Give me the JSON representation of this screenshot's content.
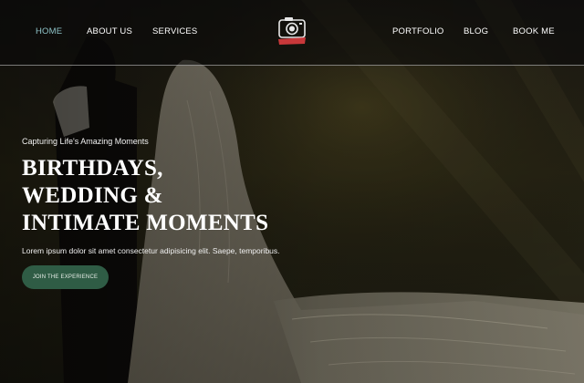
{
  "nav": {
    "left": [
      {
        "label": "HOME",
        "active": true
      },
      {
        "label": "ABOUT US",
        "active": false
      },
      {
        "label": "SERVICES",
        "active": false
      }
    ],
    "right": [
      {
        "label": "PORTFOLIO",
        "active": false
      },
      {
        "label": "BLOG",
        "active": false
      },
      {
        "label": "BOOK ME",
        "active": false
      }
    ]
  },
  "logo": {
    "icon": "camera-icon",
    "ribbon_color": "#c8383a"
  },
  "hero": {
    "tagline": "Capturing Life's Amazing Moments",
    "headline": [
      "BIRTHDAYS,",
      "WEDDING &",
      "INTIMATE MOMENTS"
    ],
    "lead": "Lorem ipsum dolor sit amet consectetur adipisicing elit. Saepe, temporibus.",
    "cta_label": "JOIN THE EXPERIENCE",
    "background": "wedding-couple-photo"
  },
  "colors": {
    "nav_active": "#8fc4c9",
    "cta_bg": "#2f5c45"
  }
}
